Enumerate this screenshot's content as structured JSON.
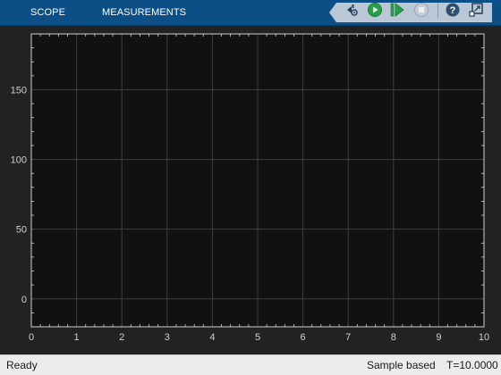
{
  "header": {
    "tabs": [
      {
        "label": "SCOPE"
      },
      {
        "label": "MEASUREMENTS"
      }
    ]
  },
  "toolbar": {
    "icons": [
      "settings-icon",
      "run-icon",
      "step-forward-icon",
      "stop-icon",
      "help-icon",
      "undock-icon"
    ],
    "help_glyph": "?"
  },
  "chart_data": {
    "type": "line",
    "x_ticks": [
      0,
      1,
      2,
      3,
      4,
      5,
      6,
      7,
      8,
      9,
      10
    ],
    "y_ticks": [
      0,
      50,
      100,
      150
    ],
    "xlim": [
      0,
      10
    ],
    "ylim": [
      -20,
      190
    ],
    "grid": true,
    "series": [],
    "background": "#111111",
    "grid_color": "#3d3d3d",
    "axes_color": "#d0d0d0"
  },
  "status": {
    "left": "Ready",
    "mode": "Sample based",
    "time": "T=10.0000"
  },
  "colors": {
    "header_bg": "#0b4f86",
    "plot_bg": "#111111",
    "status_bg": "#ececec"
  }
}
